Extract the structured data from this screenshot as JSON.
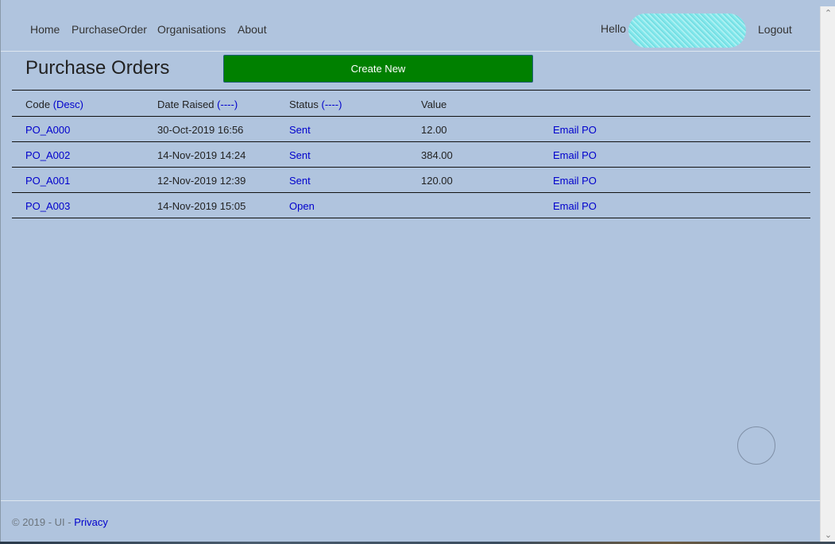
{
  "nav": {
    "links": [
      "Home",
      "PurchaseOrder",
      "Organisations",
      "About"
    ],
    "hello": "Hello",
    "logout": "Logout"
  },
  "page": {
    "title": "Purchase Orders",
    "create_button": "Create New"
  },
  "table": {
    "headers": {
      "code": "Code",
      "code_sort": "(Desc)",
      "date": "Date Raised",
      "date_sort": "(----)",
      "status": "Status",
      "status_sort": "(----)",
      "value": "Value"
    },
    "rows": [
      {
        "code": "PO_A000",
        "date": "30-Oct-2019 16:56",
        "status": "Sent",
        "value": "12.00",
        "action": "Email PO"
      },
      {
        "code": "PO_A002",
        "date": "14-Nov-2019 14:24",
        "status": "Sent",
        "value": "384.00",
        "action": "Email PO"
      },
      {
        "code": "PO_A001",
        "date": "12-Nov-2019 12:39",
        "status": "Sent",
        "value": "120.00",
        "action": "Email PO"
      },
      {
        "code": "PO_A003",
        "date": "14-Nov-2019 15:05",
        "status": "Open",
        "value": "",
        "action": "Email PO"
      }
    ]
  },
  "footer": {
    "text": "© 2019 - UI -",
    "privacy": "Privacy"
  },
  "colors": {
    "background": "#b0c4de",
    "button": "#008000",
    "link": "#0000cc"
  },
  "icons": {
    "scroll_up": "chevron-up-icon",
    "scroll_down": "chevron-down-icon"
  }
}
